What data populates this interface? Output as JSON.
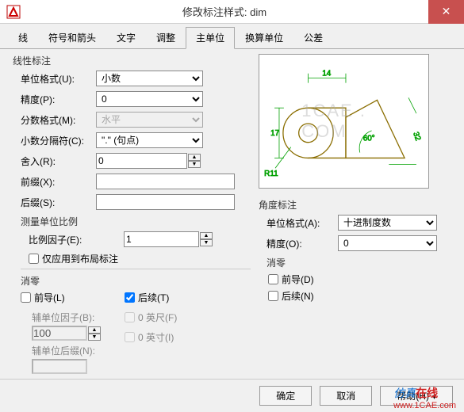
{
  "title": "修改标注样式: dim",
  "tabs": [
    "线",
    "符号和箭头",
    "文字",
    "调整",
    "主单位",
    "换算单位",
    "公差"
  ],
  "active_tab": "主单位",
  "linear": {
    "group": "线性标注",
    "unit_format_label": "单位格式(U):",
    "unit_format_value": "小数",
    "precision_label": "精度(P):",
    "precision_value": "0",
    "fraction_format_label": "分数格式(M):",
    "fraction_format_value": "水平",
    "decimal_sep_label": "小数分隔符(C):",
    "decimal_sep_value": "\".\" (句点)",
    "round_label": "舍入(R):",
    "round_value": "0",
    "prefix_label": "前缀(X):",
    "prefix_value": "",
    "suffix_label": "后缀(S):",
    "suffix_value": ""
  },
  "scale": {
    "group": "测量单位比例",
    "factor_label": "比例因子(E):",
    "factor_value": "1",
    "layout_only": "仅应用到布局标注"
  },
  "suppress": {
    "group": "消零",
    "leading": "前导(L)",
    "trailing": "后续(T)",
    "aux_factor_label": "辅单位因子(B):",
    "aux_factor_value": "100",
    "aux_suffix_label": "辅单位后缀(N):",
    "aux_suffix_value": "",
    "feet": "0 英尺(F)",
    "inches": "0 英寸(I)"
  },
  "angle": {
    "group": "角度标注",
    "unit_format_label": "单位格式(A):",
    "unit_format_value": "十进制度数",
    "precision_label": "精度(O):",
    "precision_value": "0",
    "suppress_group": "消零",
    "leading": "前导(D)",
    "trailing": "后续(N)"
  },
  "preview": {
    "d1": "14",
    "d2": "17",
    "d3": "32",
    "r": "R11",
    "ang": "60°"
  },
  "footer": {
    "ok": "确定",
    "cancel": "取消",
    "help": "帮助(H)"
  },
  "watermark": {
    "brand_a": "仿真",
    "brand_b": "在线",
    "url": "www.1CAE.com",
    "center": "1CAE . COM"
  }
}
